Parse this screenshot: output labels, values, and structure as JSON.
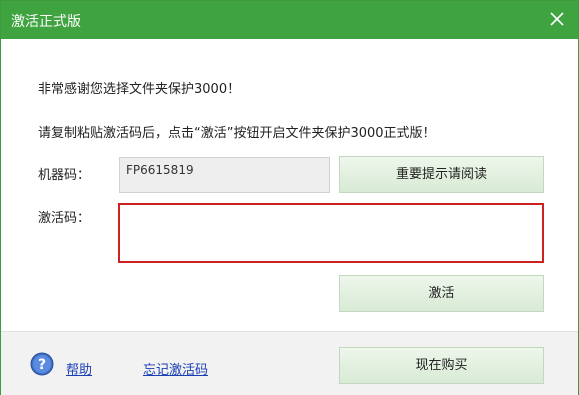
{
  "window": {
    "title": "激活正式版",
    "close_icon": "close-icon"
  },
  "intro": {
    "line1": "非常感谢您选择文件夹保护3000！",
    "line2": "请复制粘贴激活码后，点击“激活”按钮开启文件夹保护3000正式版！"
  },
  "machine": {
    "label": "机器码：",
    "value": "FP6615819"
  },
  "notice_button": "重要提示请阅读",
  "activation": {
    "label": "激活码：",
    "value": "",
    "placeholder": ""
  },
  "activate_button": "激活",
  "footer": {
    "help_icon": "question-icon",
    "help_link": "帮助",
    "forgot_link": "忘记激活码",
    "buy_button": "现在购买"
  },
  "colors": {
    "titlebar": "#3fa33f",
    "input_border": "#cc2222",
    "link": "#1a3fb5",
    "button": "#d8ebd4"
  }
}
